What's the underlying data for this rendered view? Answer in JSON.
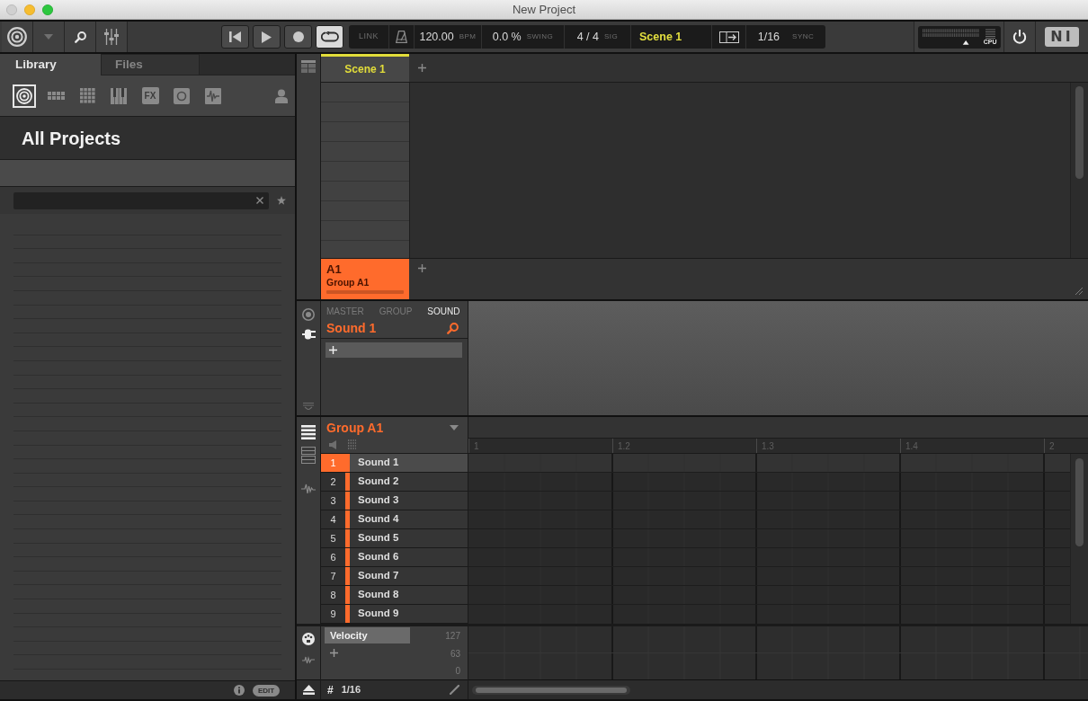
{
  "window": {
    "title": "New Project"
  },
  "toolbar": {
    "transport": [
      {
        "kind": "previous",
        "on": false
      },
      {
        "kind": "play",
        "on": false
      },
      {
        "kind": "record",
        "on": false
      },
      {
        "kind": "loop",
        "on": true
      }
    ],
    "link": "LINK",
    "tempo": {
      "value": "120.00",
      "unit": "BPM"
    },
    "swing": {
      "value": "0.0 %",
      "unit": "SWING"
    },
    "signature": {
      "value": "4 / 4",
      "unit": "SIG"
    },
    "scene": "Scene 1",
    "sync": {
      "value": "1/16",
      "unit": "SYNC"
    },
    "cpu_label": "CPU",
    "logo": "NI"
  },
  "browser": {
    "tabs": [
      {
        "label": "Library",
        "selected": true
      },
      {
        "label": "Files",
        "selected": false
      }
    ],
    "filters": [
      {
        "kind": "projects",
        "selected": true
      },
      {
        "kind": "groups",
        "selected": false
      },
      {
        "kind": "sounds",
        "selected": false
      },
      {
        "kind": "instruments",
        "selected": false
      },
      {
        "kind": "effects",
        "label": "FX",
        "selected": false
      },
      {
        "kind": "loops",
        "selected": false
      },
      {
        "kind": "one_shots",
        "selected": false
      }
    ],
    "title": "All Projects",
    "edit": "EDIT"
  },
  "arranger": {
    "scenes": [
      {
        "label": "Scene 1",
        "selected": true
      }
    ],
    "groups": [
      {
        "slot": "A1",
        "name": "Group A1",
        "color": "#ff6b2c"
      }
    ]
  },
  "control": {
    "tabs": [
      {
        "label": "MASTER",
        "selected": false
      },
      {
        "label": "GROUP",
        "selected": false
      },
      {
        "label": "SOUND",
        "selected": true
      }
    ],
    "title": "Sound 1"
  },
  "pattern": {
    "group": "Group A1",
    "ruler": [
      "1",
      "1.2",
      "1.3",
      "1.4",
      "2"
    ],
    "sounds": [
      {
        "number": "1",
        "name": "Sound 1",
        "selected": true
      },
      {
        "number": "2",
        "name": "Sound 2",
        "selected": false
      },
      {
        "number": "3",
        "name": "Sound 3",
        "selected": false
      },
      {
        "number": "4",
        "name": "Sound 4",
        "selected": false
      },
      {
        "number": "5",
        "name": "Sound 5",
        "selected": false
      },
      {
        "number": "6",
        "name": "Sound 6",
        "selected": false
      },
      {
        "number": "7",
        "name": "Sound 7",
        "selected": false
      },
      {
        "number": "8",
        "name": "Sound 8",
        "selected": false
      },
      {
        "number": "9",
        "name": "Sound 9",
        "selected": false
      }
    ],
    "lanes": [
      {
        "label": "Velocity",
        "selected": true
      }
    ],
    "scale": [
      "127",
      "63",
      "0"
    ],
    "grid_symbol": "#",
    "step": "1/16"
  }
}
